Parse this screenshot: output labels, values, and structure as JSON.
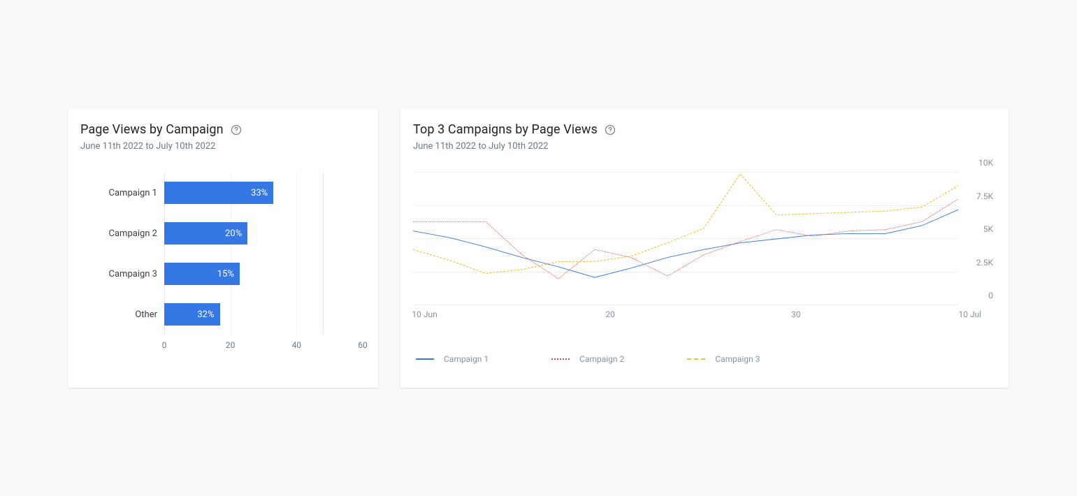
{
  "left_card": {
    "title": "Page Views by Campaign",
    "subtitle": "June 11th 2022 to July 10th 2022"
  },
  "right_card": {
    "title": "Top 3 Campaigns by Page Views",
    "subtitle": "June 11th 2022 to July 10th 2022"
  },
  "bar_ticks": {
    "t0": "0",
    "t1": "20",
    "t2": "40",
    "t3": "60"
  },
  "bar_labels": {
    "r0": "Campaign 1",
    "r1": "Campaign 2",
    "r2": "Campaign 3",
    "r3": "Other"
  },
  "bar_values": {
    "r0": "33%",
    "r1": "20%",
    "r2": "15%",
    "r3": "32%"
  },
  "line_yticks": {
    "y0": "0",
    "y1": "2.5K",
    "y2": "5K",
    "y3": "7.5K",
    "y4": "10K"
  },
  "line_xticks": {
    "x0": "10 Jun",
    "x1": "20",
    "x2": "30",
    "x3": "10 Jul"
  },
  "legend": {
    "l0": "Campaign 1",
    "l1": "Campaign 2",
    "l2": "Campaign 3"
  },
  "colors": {
    "bar": "#3578e5",
    "c1": "#3578e5",
    "c2": "#d94b4b",
    "c3": "#f2c032"
  },
  "chart_data": [
    {
      "type": "bar",
      "orientation": "horizontal",
      "title": "Page Views by Campaign",
      "subtitle": "June 11th 2022 to July 10th 2022",
      "xlabel": "",
      "ylabel": "",
      "xlim": [
        0,
        60
      ],
      "categories": [
        "Campaign 1",
        "Campaign 2",
        "Campaign 3",
        "Other"
      ],
      "values_pct": [
        33,
        20,
        15,
        32
      ],
      "value_labels": [
        "33%",
        "20%",
        "15%",
        "32%"
      ]
    },
    {
      "type": "line",
      "title": "Top 3 Campaigns by Page Views",
      "subtitle": "June 11th 2022 to July 10th 2022",
      "xlabel": "",
      "ylabel": "",
      "ylim": [
        0,
        10000
      ],
      "x": [
        10,
        12,
        14,
        16,
        18,
        20,
        22,
        24,
        26,
        28,
        30,
        32,
        34,
        36,
        38,
        40
      ],
      "x_tick_labels": [
        "10 Jun",
        "20",
        "30",
        "10 Jul"
      ],
      "y_tick_labels": [
        "0",
        "2.5K",
        "5K",
        "7.5K",
        "10K"
      ],
      "series": [
        {
          "name": "Campaign 1",
          "color": "#3578e5",
          "style": "solid",
          "values": [
            5600,
            5100,
            4400,
            3600,
            2900,
            2100,
            2800,
            3600,
            4200,
            4700,
            5000,
            5300,
            5400,
            5400,
            6000,
            7200
          ]
        },
        {
          "name": "Campaign 2",
          "color": "#d94b4b",
          "style": "dotted",
          "values": [
            6300,
            6300,
            6300,
            3800,
            2000,
            4200,
            3600,
            2200,
            3800,
            4800,
            5700,
            5200,
            5600,
            5700,
            6300,
            8000
          ]
        },
        {
          "name": "Campaign 3",
          "color": "#f2c032",
          "style": "dashed",
          "values": [
            4200,
            3400,
            2400,
            2700,
            3300,
            3300,
            3700,
            4700,
            5800,
            9900,
            6800,
            6900,
            7000,
            7100,
            7400,
            9000
          ]
        }
      ],
      "legend_position": "bottom"
    }
  ]
}
